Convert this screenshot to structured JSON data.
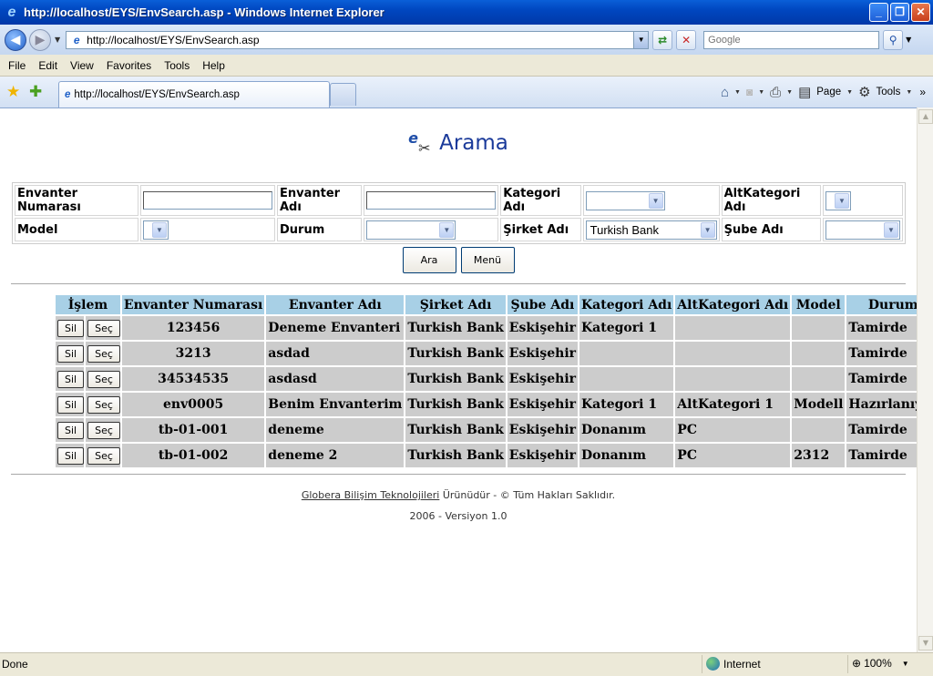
{
  "window": {
    "title": "http://localhost/EYS/EnvSearch.asp - Windows Internet Explorer",
    "minimize": "_",
    "maximize": "❐",
    "close": "✕"
  },
  "addressbar": {
    "url": "http://localhost/EYS/EnvSearch.asp",
    "search_placeholder": "Google"
  },
  "menu": [
    "File",
    "Edit",
    "View",
    "Favorites",
    "Tools",
    "Help"
  ],
  "tab": {
    "label": "http://localhost/EYS/EnvSearch.asp"
  },
  "commandbar": {
    "page_label": "Page",
    "tools_label": "Tools"
  },
  "page": {
    "heading": "Arama",
    "form": {
      "envanter_no_label": "Envanter Numarası",
      "envanter_adi_label": "Envanter Adı",
      "kategori_label": "Kategori Adı",
      "altkategori_label": "AltKategori Adı",
      "model_label": "Model",
      "durum_label": "Durum",
      "sirket_label": "Şirket Adı",
      "sirket_value": "Turkish Bank",
      "sube_label": "Şube Adı"
    },
    "buttons": {
      "search": "Ara",
      "menu": "Menü"
    },
    "results": {
      "headers": [
        "İşlem",
        "Envanter Numarası",
        "Envanter Adı",
        "Şirket Adı",
        "Şube Adı",
        "Kategori Adı",
        "AltKategori Adı",
        "Model",
        "Durum"
      ],
      "sil_label": "Sil",
      "sec_label": "Seç",
      "rows": [
        {
          "no": "123456",
          "adi": "Deneme Envanteri",
          "sirket": "Turkish Bank",
          "sube": "Eskişehir",
          "kategori": "Kategori 1",
          "altkategori": "",
          "model": "",
          "durum": "Tamirde"
        },
        {
          "no": "3213",
          "adi": "asdad",
          "sirket": "Turkish Bank",
          "sube": "Eskişehir",
          "kategori": "",
          "altkategori": "",
          "model": "",
          "durum": "Tamirde"
        },
        {
          "no": "34534535",
          "adi": "asdasd",
          "sirket": "Turkish Bank",
          "sube": "Eskişehir",
          "kategori": "",
          "altkategori": "",
          "model": "",
          "durum": "Tamirde"
        },
        {
          "no": "env0005",
          "adi": "Benim Envanterim",
          "sirket": "Turkish Bank",
          "sube": "Eskişehir",
          "kategori": "Kategori 1",
          "altkategori": "AltKategori 1",
          "model": "Modell",
          "durum": "Hazırlanıyor"
        },
        {
          "no": "tb-01-001",
          "adi": "deneme",
          "sirket": "Turkish Bank",
          "sube": "Eskişehir",
          "kategori": "Donanım",
          "altkategori": "PC",
          "model": "",
          "durum": "Tamirde"
        },
        {
          "no": "tb-01-002",
          "adi": "deneme 2",
          "sirket": "Turkish Bank",
          "sube": "Eskişehir",
          "kategori": "Donanım",
          "altkategori": "PC",
          "model": "2312",
          "durum": "Tamirde"
        }
      ]
    },
    "footer": {
      "company_link": "Globera Bilişim Teknolojileri",
      "rights": " Ürünüdür - © Tüm Hakları Saklıdır.",
      "version": "2006 - Versiyon 1.0"
    }
  },
  "status": {
    "text": "Done",
    "zone": "Internet",
    "zoom": "100%"
  },
  "colors": {
    "header_bg": "#a8d0e6",
    "row_bg": "#cccccc",
    "heading_color": "#1a3a9a"
  }
}
